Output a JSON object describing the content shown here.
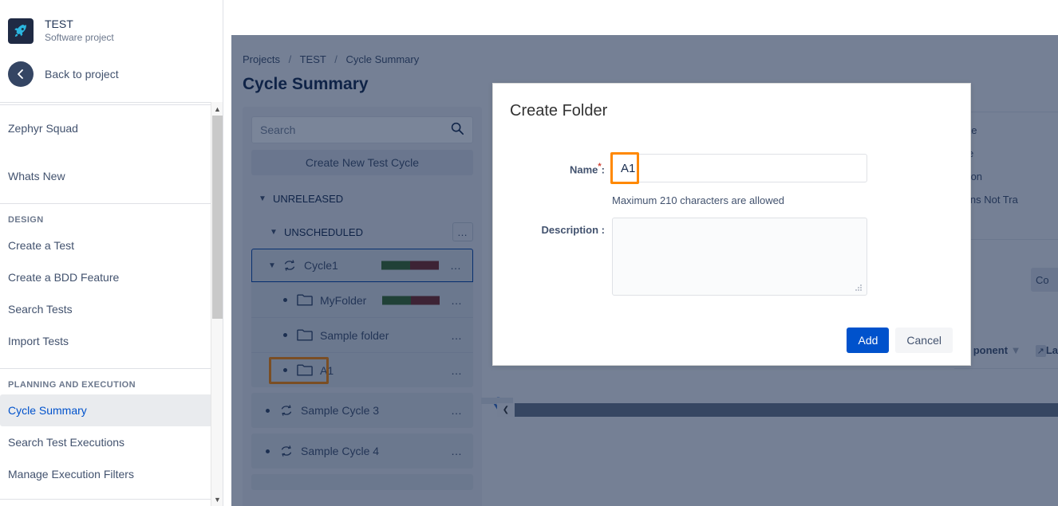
{
  "sidebar": {
    "project": {
      "name": "TEST",
      "type": "Software project",
      "avatar_icon": "rocket-icon"
    },
    "back": {
      "label": "Back to project",
      "icon": "arrow-left-icon"
    },
    "top_items": [
      {
        "label": "Zephyr Squad"
      },
      {
        "label": "Whats New"
      }
    ],
    "sections": [
      {
        "title": "DESIGN",
        "items": [
          {
            "label": "Create a Test",
            "selected": false
          },
          {
            "label": "Create a BDD Feature",
            "selected": false
          },
          {
            "label": "Search Tests",
            "selected": false
          },
          {
            "label": "Import Tests",
            "selected": false
          }
        ]
      },
      {
        "title": "PLANNING AND EXECUTION",
        "items": [
          {
            "label": "Cycle Summary",
            "selected": true
          },
          {
            "label": "Search Test Executions",
            "selected": false
          },
          {
            "label": "Manage Execution Filters",
            "selected": false
          }
        ]
      }
    ]
  },
  "page": {
    "breadcrumb": {
      "items": [
        "Projects",
        "TEST",
        "Cycle Summary"
      ],
      "separator": "/"
    },
    "title": "Cycle Summary"
  },
  "tree": {
    "search": {
      "placeholder": "Search",
      "value": "",
      "icon": "search-icon"
    },
    "create_button": "Create New Test Cycle",
    "release_group": {
      "label": "UNRELEASED",
      "caret": "chevron-down-icon"
    },
    "version_group": {
      "label": "UNSCHEDULED",
      "caret": "chevron-down-icon",
      "menu": "…"
    },
    "cycles": [
      {
        "name": "Cycle1",
        "icon": "cycle-icon",
        "expanded": true,
        "selected": true,
        "progress": {
          "pass_pct": 48,
          "fail_pct": 52,
          "pass_color": "#3c6b2b",
          "fail_color": "#7a2b25"
        },
        "children": [
          {
            "name": "MyFolder",
            "icon": "folder-icon",
            "progress": {
              "pass_pct": 48,
              "fail_pct": 52,
              "pass_color": "#3c6b2b",
              "fail_color": "#7a2b25"
            },
            "highlighted": false
          },
          {
            "name": "Sample folder",
            "icon": "folder-icon",
            "progress": null,
            "highlighted": false
          },
          {
            "name": "A1",
            "icon": "folder-icon",
            "progress": null,
            "highlighted": true
          }
        ]
      },
      {
        "name": "Sample Cycle 3",
        "icon": "cycle-icon",
        "expanded": false,
        "children": []
      },
      {
        "name": "Sample Cycle 4",
        "icon": "cycle-icon",
        "expanded": false,
        "children": []
      }
    ],
    "row_menu_glyph": "…"
  },
  "detail_panel": {
    "labels": [
      "Start Date",
      "End Date",
      "Description",
      "Executions Not Tra"
    ],
    "compare_button": "Co",
    "component_filter": "ponent",
    "label_filter": "La"
  },
  "modal": {
    "title": "Create Folder",
    "name_label": "Name",
    "name_required_marker": "*",
    "name_colon": ":",
    "name_value": "A1",
    "name_help": "Maximum 210 characters are allowed",
    "description_label": "Description",
    "description_colon": ":",
    "description_value": "",
    "add_label": "Add",
    "cancel_label": "Cancel"
  },
  "colors": {
    "accent_blue": "#0052cc",
    "highlight_orange": "#ff8800",
    "overlay": "rgba(9,30,66,0.54)",
    "pass_green": "#3c6b2b",
    "fail_red": "#7a2b25"
  }
}
